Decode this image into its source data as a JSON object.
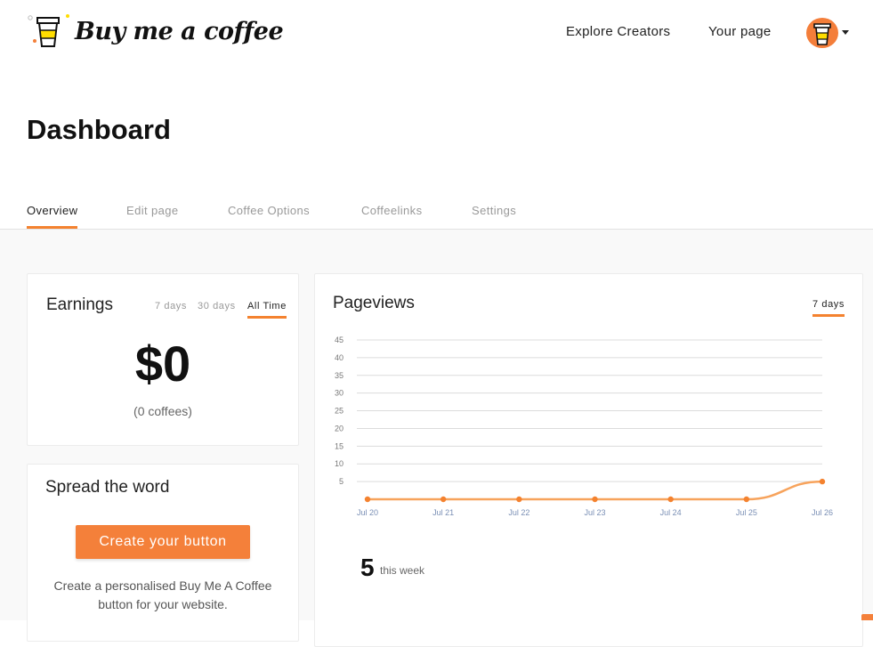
{
  "header": {
    "logo_text": "Buy me a coffee",
    "nav": {
      "explore": "Explore Creators",
      "your_page": "Your page"
    }
  },
  "page_title": "Dashboard",
  "tabs": [
    {
      "label": "Overview",
      "active": true
    },
    {
      "label": "Edit page",
      "active": false
    },
    {
      "label": "Coffee Options",
      "active": false
    },
    {
      "label": "Coffeelinks",
      "active": false
    },
    {
      "label": "Settings",
      "active": false
    }
  ],
  "earnings": {
    "title": "Earnings",
    "ranges": [
      "7 days",
      "30 days",
      "All Time"
    ],
    "active_range": "All Time",
    "amount": "$0",
    "coffees": "(0 coffees)"
  },
  "spread": {
    "title": "Spread the word",
    "button": "Create your button",
    "description": "Create a personalised Buy Me A Coffee button for your website."
  },
  "pageviews": {
    "title": "Pageviews",
    "range": "7 days",
    "week_count": "5",
    "week_label": "this week"
  },
  "colors": {
    "accent": "#f4822f",
    "line": "#f7a35c"
  },
  "chart_data": {
    "type": "line",
    "categories": [
      "Jul 20",
      "Jul 21",
      "Jul 22",
      "Jul 23",
      "Jul 24",
      "Jul 25",
      "Jul 26"
    ],
    "values": [
      0,
      0,
      0,
      0,
      0,
      0,
      5
    ],
    "yticks": [
      5,
      10,
      15,
      20,
      25,
      30,
      35,
      40,
      45
    ],
    "ylim": [
      0,
      45
    ],
    "grid": true,
    "title": "",
    "xlabel": "",
    "ylabel": ""
  }
}
